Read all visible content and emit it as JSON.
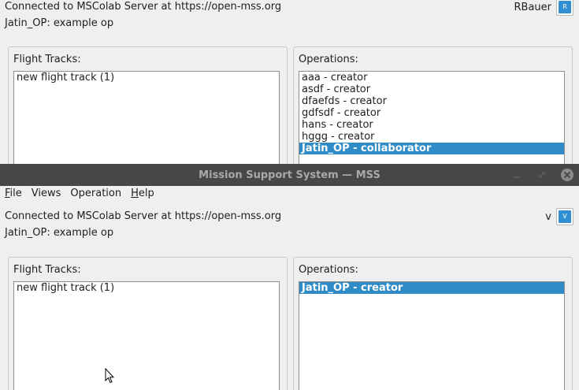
{
  "back_window": {
    "status_text": "Connected to MSColab Server at https://open-mss.org",
    "operation_text": "Jatin_OP: example op",
    "username": "RBauer",
    "avatar_letter": "R",
    "flight_tracks": {
      "label": "Flight Tracks:",
      "items": [
        "new flight track (1)"
      ]
    },
    "operations": {
      "label": "Operations:",
      "items": [
        {
          "text": "aaa - creator",
          "selected": false
        },
        {
          "text": "asdf - creator",
          "selected": false
        },
        {
          "text": "dfaefds - creator",
          "selected": false
        },
        {
          "text": "gdfsdf - creator",
          "selected": false
        },
        {
          "text": "hans - creator",
          "selected": false
        },
        {
          "text": "hggg - creator",
          "selected": false
        },
        {
          "text": "Jatin_OP - collaborator",
          "selected": true
        }
      ]
    }
  },
  "front_window": {
    "title": "Mission Support System — MSS",
    "menu": [
      {
        "mnemonic": "F",
        "rest": "ile"
      },
      {
        "mnemonic": "",
        "rest": "Views"
      },
      {
        "mnemonic": "",
        "rest": "Operation"
      },
      {
        "mnemonic": "H",
        "rest": "elp"
      }
    ],
    "status_text": "Connected to MSColab Server at https://open-mss.org",
    "operation_text": "Jatin_OP: example op",
    "username": "v",
    "avatar_letter": "V",
    "flight_tracks": {
      "label": "Flight Tracks:",
      "items": [
        "new flight track (1)"
      ]
    },
    "operations": {
      "label": "Operations:",
      "items": [
        {
          "text": "Jatin_OP - creator",
          "selected": true
        }
      ]
    }
  },
  "colors": {
    "selection": "#308cc6",
    "avatar": "#2f8fd0",
    "titlebar": "#474747"
  }
}
